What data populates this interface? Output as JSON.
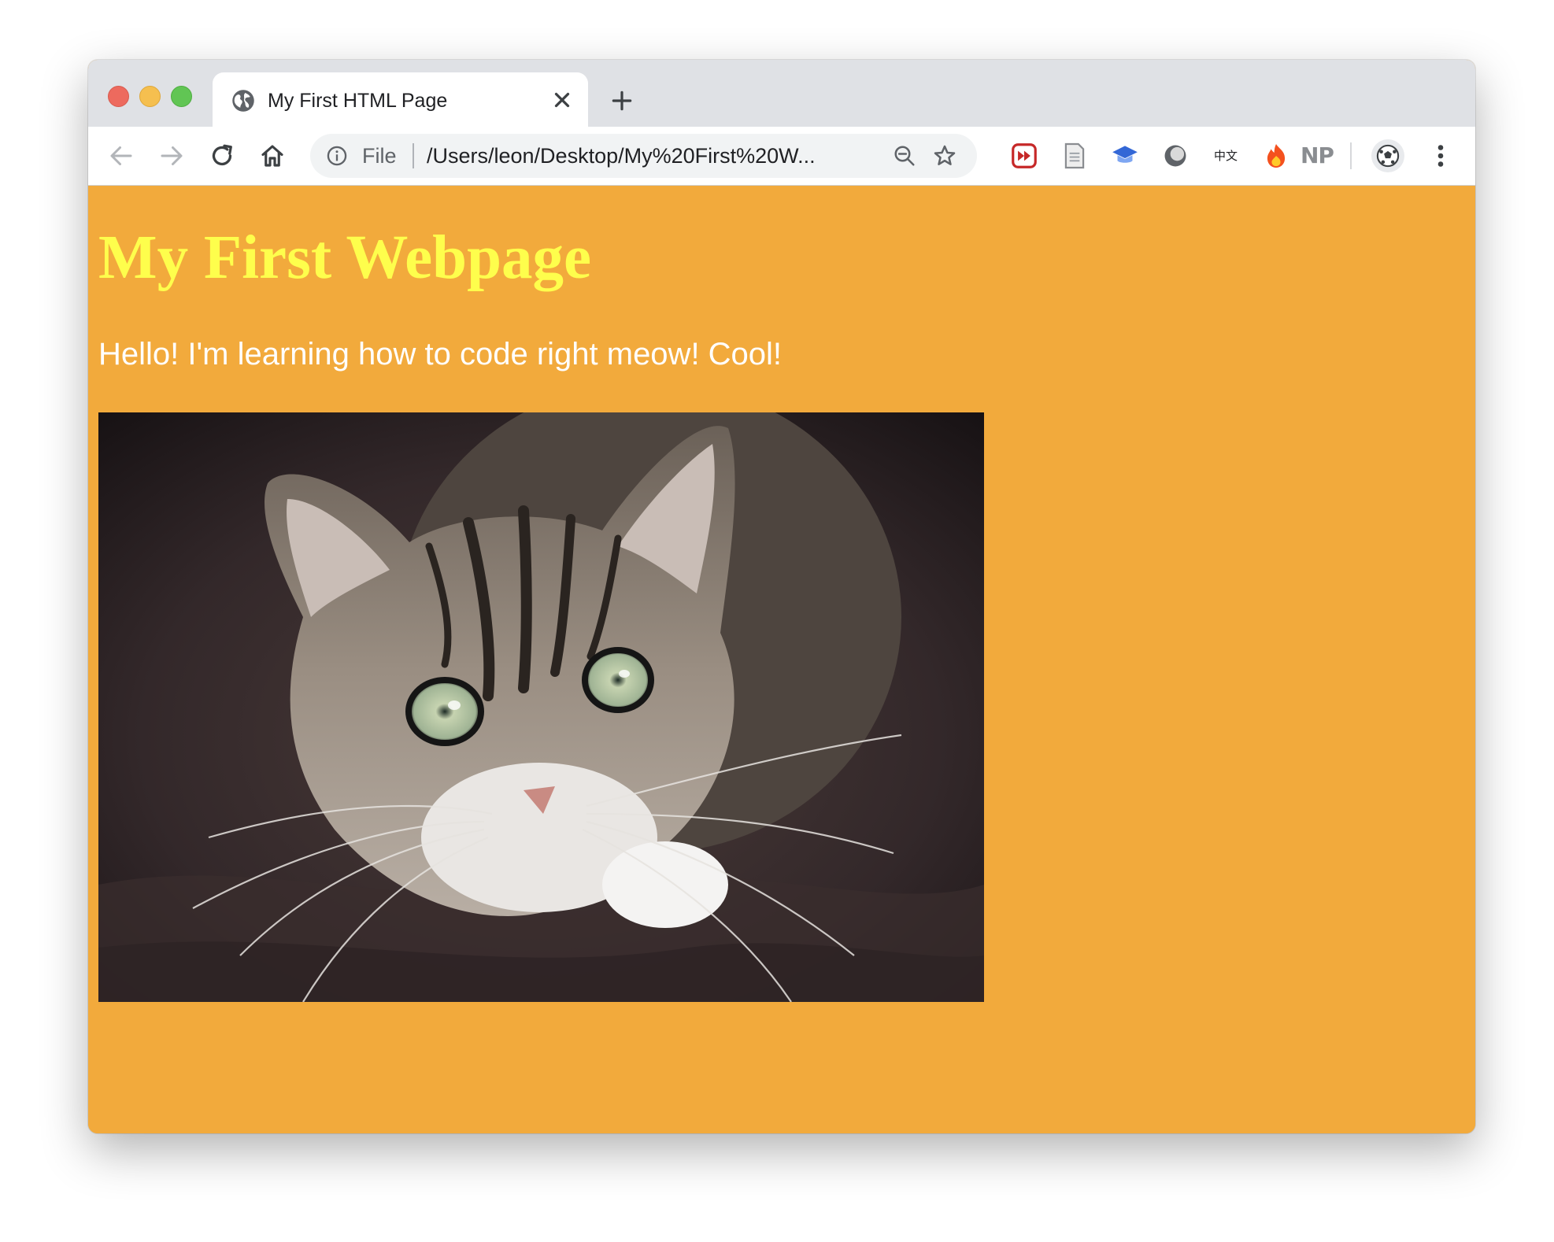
{
  "browser": {
    "tab": {
      "title": "My First HTML Page",
      "icon": "globe-icon"
    },
    "omnibox": {
      "scheme_label": "File",
      "url": "/Users/leon/Desktop/My%20First%20W..."
    },
    "extensions": {
      "np_label": "NP",
      "chinese_label": "中文"
    }
  },
  "page": {
    "heading": "My First Webpage",
    "paragraph": "Hello! I'm learning how to code right meow! Cool!",
    "image_alt": "cat",
    "background_color": "#f2aa3c",
    "heading_color": "#fefe4c",
    "paragraph_color": "#ffffff"
  }
}
